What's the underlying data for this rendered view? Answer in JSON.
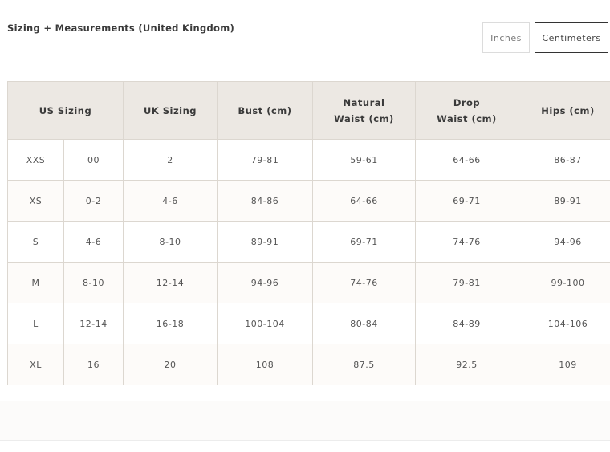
{
  "page": {
    "title": "Sizing + Measurements (United Kingdom)"
  },
  "units": {
    "inches_label": "Inches",
    "centimeters_label": "Centimeters",
    "selected": "Centimeters"
  },
  "table": {
    "headers": {
      "us_sizing": "US Sizing",
      "uk_sizing": "UK Sizing",
      "bust": "Bust (cm)",
      "natural_waist_line1": "Natural",
      "natural_waist_line2": "Waist (cm)",
      "drop_waist_line1": "Drop",
      "drop_waist_line2": "Waist (cm)",
      "hips": "Hips (cm)"
    },
    "rows": [
      {
        "us_letter": "XXS",
        "us_number": "00",
        "uk": "2",
        "bust": "79-81",
        "natural_waist": "59-61",
        "drop_waist": "64-66",
        "hips": "86-87"
      },
      {
        "us_letter": "XS",
        "us_number": "0-2",
        "uk": "4-6",
        "bust": "84-86",
        "natural_waist": "64-66",
        "drop_waist": "69-71",
        "hips": "89-91"
      },
      {
        "us_letter": "S",
        "us_number": "4-6",
        "uk": "8-10",
        "bust": "89-91",
        "natural_waist": "69-71",
        "drop_waist": "74-76",
        "hips": "94-96"
      },
      {
        "us_letter": "M",
        "us_number": "8-10",
        "uk": "12-14",
        "bust": "94-96",
        "natural_waist": "74-76",
        "drop_waist": "79-81",
        "hips": "99-100"
      },
      {
        "us_letter": "L",
        "us_number": "12-14",
        "uk": "16-18",
        "bust": "100-104",
        "natural_waist": "80-84",
        "drop_waist": "84-89",
        "hips": "104-106"
      },
      {
        "us_letter": "XL",
        "us_number": "16",
        "uk": "20",
        "bust": "108",
        "natural_waist": "87.5",
        "drop_waist": "92.5",
        "hips": "109"
      }
    ]
  },
  "colors": {
    "header_bg": "#ece8e3",
    "border": "#dcd7d0",
    "active_border": "#333333"
  }
}
